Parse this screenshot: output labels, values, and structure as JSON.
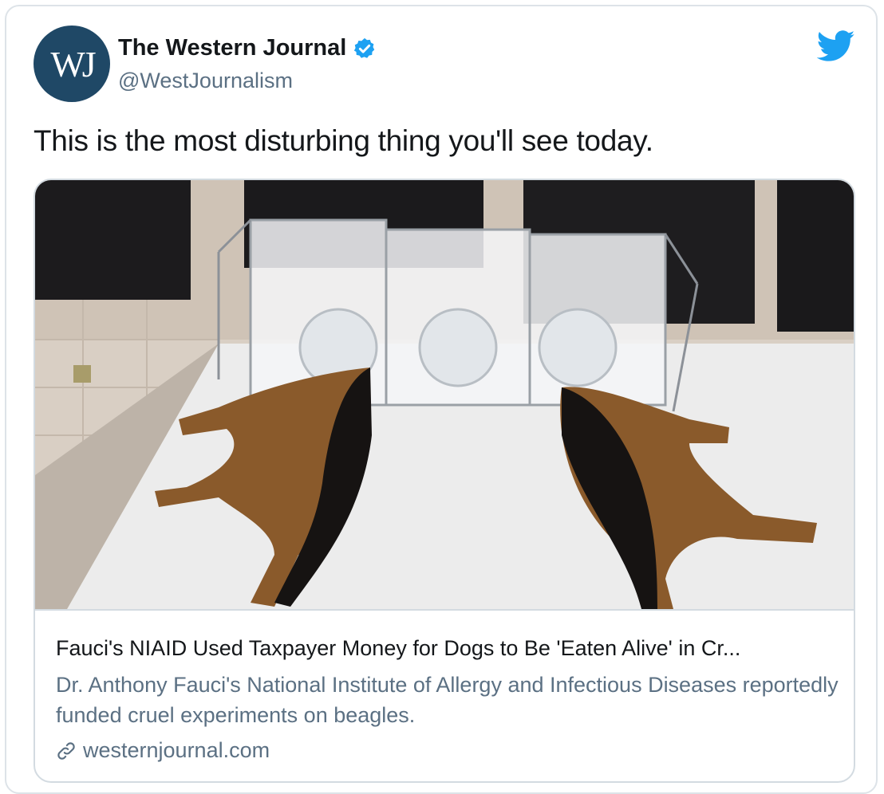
{
  "author": {
    "avatar_text": "WJ",
    "display_name": "The Western Journal",
    "handle": "@WestJournalism",
    "verified": true
  },
  "tweet": {
    "text": "This is the most disturbing thing you'll see today."
  },
  "card": {
    "title": "Fauci's NIAID Used Taxpayer Money for Dogs to Be 'Eaten Alive' in Cr...",
    "description": "Dr. Anthony Fauci's National Institute of Allergy and Infectious Diseases reportedly funded cruel experiments on beagles.",
    "domain": "westernjournal.com"
  },
  "colors": {
    "brand_twitter": "#1da1f2",
    "avatar_bg": "#1f4866",
    "text_primary": "#14171a",
    "text_secondary": "#5b7083"
  },
  "icons": {
    "verified": "verified-badge-icon",
    "twitter": "twitter-bird-icon",
    "link": "link-icon"
  }
}
